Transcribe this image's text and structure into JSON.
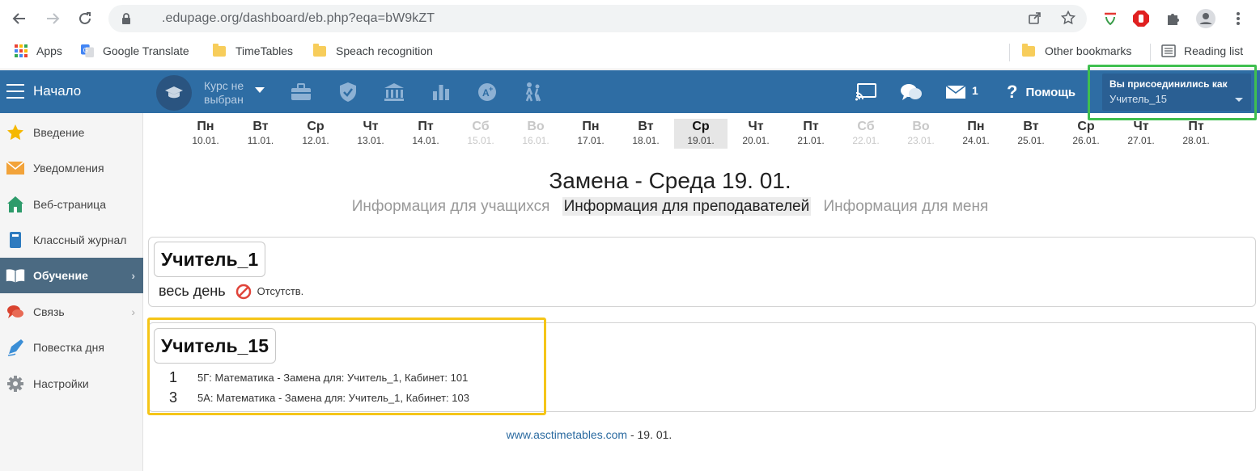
{
  "browser": {
    "url": ".edupage.org/dashboard/eb.php?eqa=bW9kZT",
    "bookmarks": [
      {
        "label": "Apps",
        "icon": "apps-grid-icon"
      },
      {
        "label": "Google Translate",
        "icon": "google-translate-icon"
      },
      {
        "label": "TimeTables",
        "icon": "folder-icon"
      },
      {
        "label": "Speach recognition",
        "icon": "folder-icon"
      }
    ],
    "other_bookmarks": "Other bookmarks",
    "reading_list": "Reading list"
  },
  "header": {
    "home_label": "Начало",
    "course_line1": "Курс не",
    "course_line2": "выбран",
    "mail_count": "1",
    "help_label": "Помощь",
    "user_title": "Вы присоединились как",
    "user_name": "Учитель_15"
  },
  "sidebar": {
    "items": [
      {
        "label": "Введение",
        "icon": "star-icon"
      },
      {
        "label": "Уведомления",
        "icon": "envelope-icon"
      },
      {
        "label": "Веб-страница",
        "icon": "house-icon"
      },
      {
        "label": "Классный журнал",
        "icon": "book-icon"
      },
      {
        "label": "Обучение",
        "icon": "open-book-icon"
      },
      {
        "label": "Связь",
        "icon": "chat-icon"
      },
      {
        "label": "Повестка дня",
        "icon": "pen-icon"
      },
      {
        "label": "Настройки",
        "icon": "gear-icon"
      }
    ]
  },
  "calendar": {
    "days": [
      {
        "name": "Пн",
        "date": "10.01."
      },
      {
        "name": "Вт",
        "date": "11.01."
      },
      {
        "name": "Ср",
        "date": "12.01."
      },
      {
        "name": "Чт",
        "date": "13.01."
      },
      {
        "name": "Пт",
        "date": "14.01."
      },
      {
        "name": "Сб",
        "date": "15.01."
      },
      {
        "name": "Во",
        "date": "16.01."
      },
      {
        "name": "Пн",
        "date": "17.01."
      },
      {
        "name": "Вт",
        "date": "18.01."
      },
      {
        "name": "Ср",
        "date": "19.01."
      },
      {
        "name": "Чт",
        "date": "20.01."
      },
      {
        "name": "Пт",
        "date": "21.01."
      },
      {
        "name": "Сб",
        "date": "22.01."
      },
      {
        "name": "Во",
        "date": "23.01."
      },
      {
        "name": "Пн",
        "date": "24.01."
      },
      {
        "name": "Вт",
        "date": "25.01."
      },
      {
        "name": "Ср",
        "date": "26.01."
      },
      {
        "name": "Чт",
        "date": "27.01."
      },
      {
        "name": "Пт",
        "date": "28.01."
      }
    ]
  },
  "main": {
    "title": "Замена - Среда 19. 01.",
    "tabs": [
      "Информация для учащихся",
      "Информация для преподавателей",
      "Информация для меня"
    ],
    "teacher1": {
      "name": "Учитель_1",
      "period": "весь день",
      "status": "Отсутств."
    },
    "teacher2": {
      "name": "Учитель_15",
      "lessons": [
        {
          "num": "1",
          "desc": "5Г: Математика - Замена для: Учитель_1, Кабинет: 101"
        },
        {
          "num": "3",
          "desc": "5А: Математика - Замена для: Учитель_1, Кабинет: 103"
        }
      ]
    }
  },
  "footer": {
    "link": "www.asctimetables.com",
    "suffix": " - 19. 01."
  },
  "colors": {
    "header_bg": "#2e6da4",
    "active_sidebar": "#4b6a82",
    "highlight_green": "#3fbf4f",
    "highlight_yellow": "#f5c518"
  }
}
